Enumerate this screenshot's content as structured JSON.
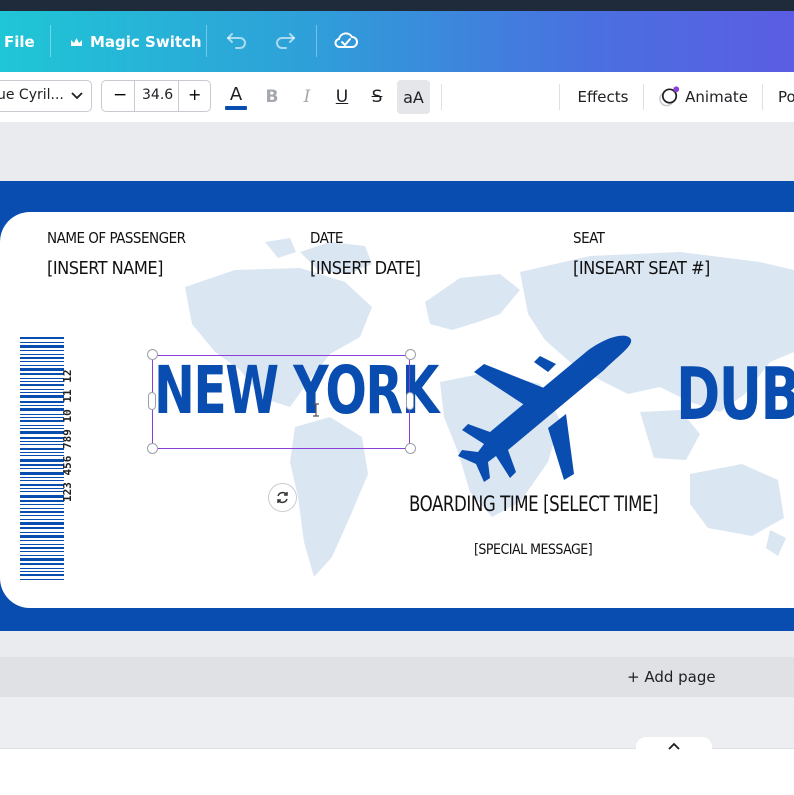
{
  "topbar": {
    "file_label": "File",
    "magic_switch_label": "Magic Switch",
    "icons": [
      "crown-icon",
      "undo-icon",
      "redo-icon",
      "cloud-sync-icon"
    ]
  },
  "toolbar": {
    "font_name": "ue Cyril...",
    "font_size": "34.6",
    "minus_label": "−",
    "plus_label": "+",
    "text_color_glyph": "A",
    "bold_glyph": "B",
    "italic_glyph": "I",
    "underline_glyph": "U",
    "strike_glyph": "S",
    "case_glyph": "aA",
    "effects_label": "Effects",
    "animate_label": "Animate",
    "position_label": "Po",
    "text_color": "#0a4db0"
  },
  "ticket": {
    "passenger_label": "NAME OF PASSENGER",
    "passenger_value": "[INSERT NAME]",
    "date_label": "DATE",
    "date_value": "[INSERT DATE]",
    "seat_label": "SEAT",
    "seat_value": "[INSEART SEAT #]",
    "origin": "NEW YORK",
    "destination": "DUBA",
    "boarding": "BOARDING TIME [SELECT TIME]",
    "special": "[SPECIAL MESSAGE]",
    "barcode_number": "123 456 789 10 11 12",
    "accent": "#0a4db0"
  },
  "page": {
    "add_page_label": "+ Add page"
  }
}
